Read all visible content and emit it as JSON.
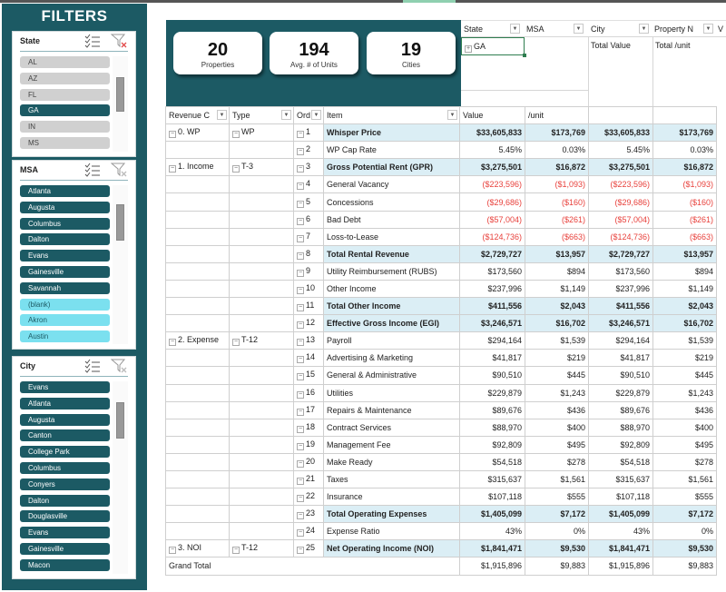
{
  "filters": {
    "title": "FILTERS",
    "slicers": [
      {
        "name": "State",
        "items": [
          {
            "label": "AL",
            "state": "grey"
          },
          {
            "label": "AZ",
            "state": "grey"
          },
          {
            "label": "FL",
            "state": "grey"
          },
          {
            "label": "GA",
            "state": "sel"
          },
          {
            "label": "IN",
            "state": "grey"
          },
          {
            "label": "MS",
            "state": "grey"
          }
        ]
      },
      {
        "name": "MSA",
        "items": [
          {
            "label": "Atlanta",
            "state": "sel"
          },
          {
            "label": "Augusta",
            "state": "sel"
          },
          {
            "label": "Columbus",
            "state": "sel"
          },
          {
            "label": "Dalton",
            "state": "sel"
          },
          {
            "label": "Evans",
            "state": "sel"
          },
          {
            "label": "Gainesville",
            "state": "sel"
          },
          {
            "label": "Savannah",
            "state": "sel"
          },
          {
            "label": "(blank)",
            "state": "light"
          },
          {
            "label": "Akron",
            "state": "light"
          },
          {
            "label": "Austin",
            "state": "light"
          }
        ]
      },
      {
        "name": "City",
        "items": [
          {
            "label": " Evans",
            "state": "sel"
          },
          {
            "label": "Atlanta",
            "state": "sel"
          },
          {
            "label": "Augusta",
            "state": "sel"
          },
          {
            "label": "Canton",
            "state": "sel"
          },
          {
            "label": "College Park",
            "state": "sel"
          },
          {
            "label": "Columbus",
            "state": "sel"
          },
          {
            "label": "Conyers",
            "state": "sel"
          },
          {
            "label": "Dalton",
            "state": "sel"
          },
          {
            "label": "Douglasville",
            "state": "sel"
          },
          {
            "label": "Evans",
            "state": "sel"
          },
          {
            "label": "Gainesville",
            "state": "sel"
          },
          {
            "label": "Macon",
            "state": "sel"
          }
        ]
      }
    ],
    "icons": {
      "multiselect": "multi-select-icon",
      "clear": "clear-filter-icon"
    }
  },
  "kpis": [
    {
      "value": "20",
      "label": "Properties"
    },
    {
      "value": "194",
      "label": "Avg. # of Units"
    },
    {
      "value": "19",
      "label": "Cities"
    }
  ],
  "pivot": {
    "filter_headers": [
      "State",
      "MSA",
      "City",
      "Property N",
      "V"
    ],
    "state_value": "GA",
    "col_labels": [
      "Total Value",
      "Total /unit"
    ],
    "row_headers": [
      "Revenue C",
      "Type",
      "Ord",
      "Item"
    ],
    "value_headers": [
      "Value",
      "/unit"
    ],
    "groups": [
      {
        "category": "0. WP",
        "type": "WP",
        "start": 0,
        "span": 2
      },
      {
        "category": "1. Income",
        "type": "T-3",
        "start": 2,
        "span": 10
      },
      {
        "category": "2. Expense",
        "type": "T-12",
        "start": 12,
        "span": 12
      },
      {
        "category": "3. NOI",
        "type": "T-12",
        "start": 24,
        "span": 1
      }
    ],
    "rows": [
      {
        "ord": "1",
        "item": "Whisper Price",
        "bold": true,
        "hl": false,
        "value": "$33,605,833",
        "unit": "$173,769",
        "tvalue": "$33,605,833",
        "tunit": "$173,769",
        "neg": false
      },
      {
        "ord": "2",
        "item": "WP Cap Rate",
        "bold": false,
        "value": "5.45%",
        "unit": "0.03%",
        "tvalue": "5.45%",
        "tunit": "0.03%",
        "neg": false
      },
      {
        "ord": "3",
        "item": "Gross Potential Rent (GPR)",
        "bold": true,
        "hl": true,
        "value": "$3,275,501",
        "unit": "$16,872",
        "tvalue": "$3,275,501",
        "tunit": "$16,872",
        "neg": false
      },
      {
        "ord": "4",
        "item": "General Vacancy",
        "bold": false,
        "value": "($223,596)",
        "unit": "($1,093)",
        "tvalue": "($223,596)",
        "tunit": "($1,093)",
        "neg": true
      },
      {
        "ord": "5",
        "item": "Concessions",
        "bold": false,
        "value": "($29,686)",
        "unit": "($160)",
        "tvalue": "($29,686)",
        "tunit": "($160)",
        "neg": true
      },
      {
        "ord": "6",
        "item": "Bad Debt",
        "bold": false,
        "value": "($57,004)",
        "unit": "($261)",
        "tvalue": "($57,004)",
        "tunit": "($261)",
        "neg": true
      },
      {
        "ord": "7",
        "item": "Loss-to-Lease",
        "bold": false,
        "value": "($124,736)",
        "unit": "($663)",
        "tvalue": "($124,736)",
        "tunit": "($663)",
        "neg": true
      },
      {
        "ord": "8",
        "item": "Total Rental Revenue",
        "bold": true,
        "hl": true,
        "value": "$2,729,727",
        "unit": "$13,957",
        "tvalue": "$2,729,727",
        "tunit": "$13,957",
        "neg": false
      },
      {
        "ord": "9",
        "item": "Utility Reimbursement (RUBS)",
        "bold": false,
        "value": "$173,560",
        "unit": "$894",
        "tvalue": "$173,560",
        "tunit": "$894",
        "neg": false
      },
      {
        "ord": "10",
        "item": "Other Income",
        "bold": false,
        "value": "$237,996",
        "unit": "$1,149",
        "tvalue": "$237,996",
        "tunit": "$1,149",
        "neg": false
      },
      {
        "ord": "11",
        "item": "Total Other Income",
        "bold": true,
        "hl": true,
        "value": "$411,556",
        "unit": "$2,043",
        "tvalue": "$411,556",
        "tunit": "$2,043",
        "neg": false
      },
      {
        "ord": "12",
        "item": "Effective Gross Income (EGI)",
        "bold": true,
        "hl": true,
        "value": "$3,246,571",
        "unit": "$16,702",
        "tvalue": "$3,246,571",
        "tunit": "$16,702",
        "neg": false
      },
      {
        "ord": "13",
        "item": "Payroll",
        "bold": false,
        "value": "$294,164",
        "unit": "$1,539",
        "tvalue": "$294,164",
        "tunit": "$1,539",
        "neg": false
      },
      {
        "ord": "14",
        "item": "Advertising & Marketing",
        "bold": false,
        "value": "$41,817",
        "unit": "$219",
        "tvalue": "$41,817",
        "tunit": "$219",
        "neg": false
      },
      {
        "ord": "15",
        "item": "General & Administrative",
        "bold": false,
        "value": "$90,510",
        "unit": "$445",
        "tvalue": "$90,510",
        "tunit": "$445",
        "neg": false
      },
      {
        "ord": "16",
        "item": "Utilities",
        "bold": false,
        "value": "$229,879",
        "unit": "$1,243",
        "tvalue": "$229,879",
        "tunit": "$1,243",
        "neg": false
      },
      {
        "ord": "17",
        "item": "Repairs & Maintenance",
        "bold": false,
        "value": "$89,676",
        "unit": "$436",
        "tvalue": "$89,676",
        "tunit": "$436",
        "neg": false
      },
      {
        "ord": "18",
        "item": "Contract Services",
        "bold": false,
        "value": "$88,970",
        "unit": "$400",
        "tvalue": "$88,970",
        "tunit": "$400",
        "neg": false
      },
      {
        "ord": "19",
        "item": "Management Fee",
        "bold": false,
        "value": "$92,809",
        "unit": "$495",
        "tvalue": "$92,809",
        "tunit": "$495",
        "neg": false
      },
      {
        "ord": "20",
        "item": "Make Ready",
        "bold": false,
        "value": "$54,518",
        "unit": "$278",
        "tvalue": "$54,518",
        "tunit": "$278",
        "neg": false
      },
      {
        "ord": "21",
        "item": "Taxes",
        "bold": false,
        "value": "$315,637",
        "unit": "$1,561",
        "tvalue": "$315,637",
        "tunit": "$1,561",
        "neg": false
      },
      {
        "ord": "22",
        "item": "Insurance",
        "bold": false,
        "value": "$107,118",
        "unit": "$555",
        "tvalue": "$107,118",
        "tunit": "$555",
        "neg": false
      },
      {
        "ord": "23",
        "item": "Total Operating Expenses",
        "bold": true,
        "hl": true,
        "value": "$1,405,099",
        "unit": "$7,172",
        "tvalue": "$1,405,099",
        "tunit": "$7,172",
        "neg": false
      },
      {
        "ord": "24",
        "item": "Expense Ratio",
        "bold": false,
        "value": "43%",
        "unit": "0%",
        "tvalue": "43%",
        "tunit": "0%",
        "neg": false
      },
      {
        "ord": "25",
        "item": "Net Operating Income (NOI)",
        "bold": true,
        "hl": true,
        "value": "$1,841,471",
        "unit": "$9,530",
        "tvalue": "$1,841,471",
        "tunit": "$9,530",
        "neg": false
      }
    ],
    "grand_total": {
      "label": "Grand Total",
      "value": "$1,915,896",
      "unit": "$9,883",
      "tvalue": "$1,915,896",
      "tunit": "$9,883"
    }
  }
}
